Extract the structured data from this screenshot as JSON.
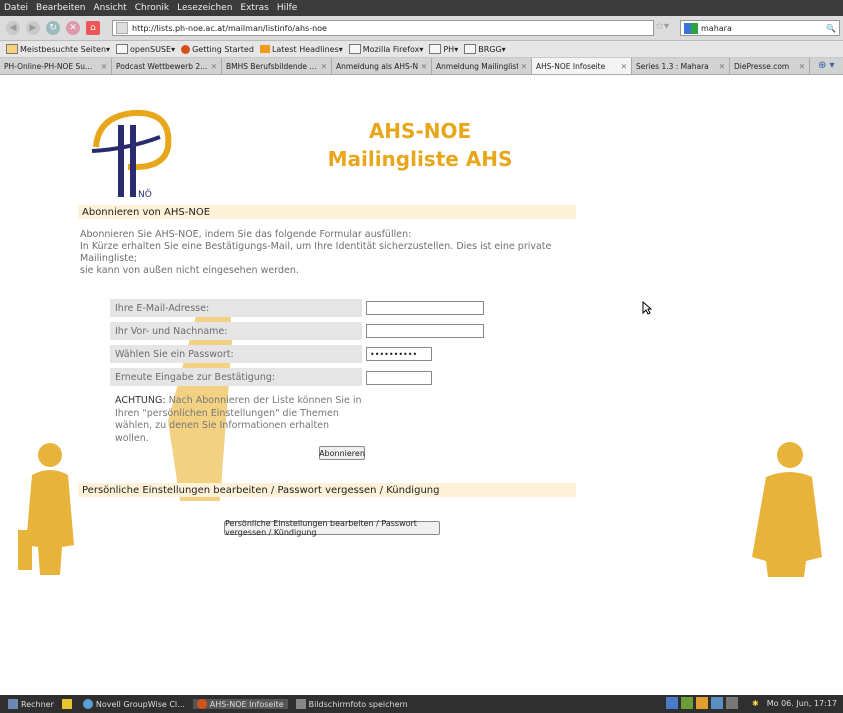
{
  "menu": [
    "Datei",
    "Bearbeiten",
    "Ansicht",
    "Chronik",
    "Lesezeichen",
    "Extras",
    "Hilfe"
  ],
  "nav": {
    "url": "http://lists.ph-noe.ac.at/mailman/listinfo/ahs-noe",
    "search_value": "mahara"
  },
  "bookmarks": [
    "Meistbesuchte Seiten",
    "openSUSE",
    "Getting Started",
    "Latest Headlines",
    "Mozilla Firefox",
    "PH",
    "BRGG"
  ],
  "tabs": [
    {
      "label": "PH-Online-PH-NOE Su..."
    },
    {
      "label": "Podcast Wettbewerb 2..."
    },
    {
      "label": "BMHS Berufsbildende ..."
    },
    {
      "label": "Anmeldung als AHS-N..."
    },
    {
      "label": "Anmeldung Mailingliste..."
    },
    {
      "label": "AHS-NOE Infoseite"
    },
    {
      "label": "Series 1.3 : Mahara"
    },
    {
      "label": "DiePresse.com"
    }
  ],
  "page": {
    "logo_text": "NÖ",
    "title": "AHS-NOE",
    "subtitle": "Mailingliste AHS",
    "subscribe_heading": "Abonnieren von AHS-NOE",
    "intro_line1": "Abonnieren Sie AHS-NOE, indem Sie das folgende Formular ausfüllen:",
    "intro_line2": "In Kürze erhalten Sie eine Bestätigungs-Mail, um Ihre Identität sicherzustellen. Dies ist eine private Mailingliste;",
    "intro_line3": "sie kann von außen nicht eingesehen werden.",
    "email_label": "Ihre E-Mail-Adresse:",
    "name_label": "Ihr Vor- und Nachname:",
    "password_label": "Wählen Sie ein Passwort:",
    "password_value": "••••••••••",
    "confirm_label": "Erneute Eingabe zur Bestätigung:",
    "note_bold": "ACHTUNG:",
    "note_text": " Nach Abonnieren der Liste können Sie in Ihren \"persönlichen Einstellungen\" die Themen wählen, zu denen Sie Informationen erhalten wollen.",
    "subscribe_button": "Abonnieren",
    "options_heading": "Persönliche Einstellungen bearbeiten / Passwort vergessen / Kündigung",
    "options_button": "Persönliche Einstellungen bearbeiten / Passwort vergessen / Kündigung"
  },
  "taskbar": {
    "items": [
      "Rechner",
      "Novell GroupWise Cl...",
      "AHS-NOE Infoseite",
      "Bildschirmfoto speichern"
    ],
    "clock": "Mo 06. Jun, 17:17"
  },
  "colors": {
    "accent": "#e8a71b",
    "heading_bg": "#fdf1d8",
    "row_bg": "#e5e5e5",
    "logo_blue": "#2a2a6e"
  }
}
